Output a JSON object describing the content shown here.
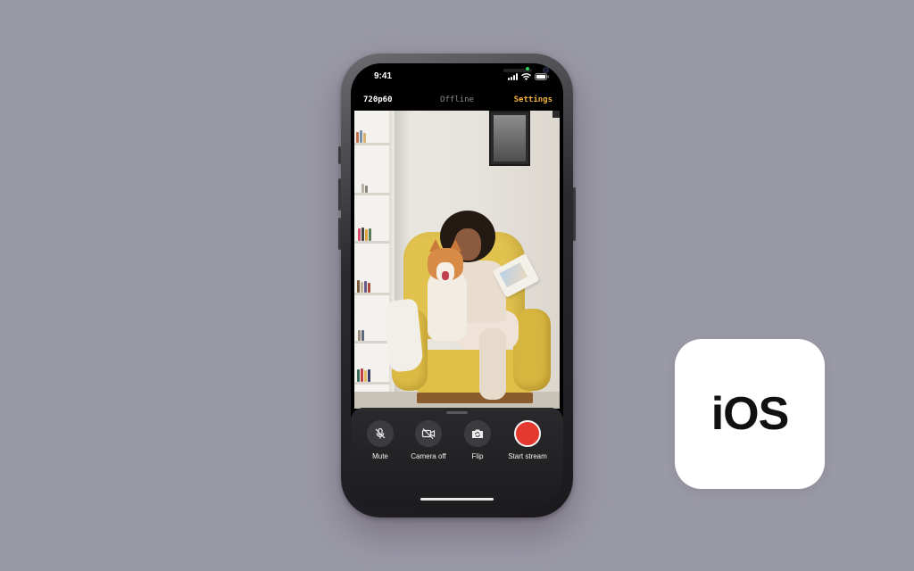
{
  "status_bar": {
    "time": "9:41"
  },
  "app_bar": {
    "resolution": "720p60",
    "stream_status": "Offline",
    "settings_label": "Settings",
    "settings_color": "#f2b23a"
  },
  "controls": [
    {
      "label": "Mute",
      "icon": "mic-off-icon"
    },
    {
      "label": "Camera off",
      "icon": "camera-off-icon"
    },
    {
      "label": "Flip",
      "icon": "flip-camera-icon"
    },
    {
      "label": "Start stream",
      "icon": "record-icon"
    }
  ],
  "record_color": "#e5382f",
  "badge": {
    "text": "iOS"
  }
}
